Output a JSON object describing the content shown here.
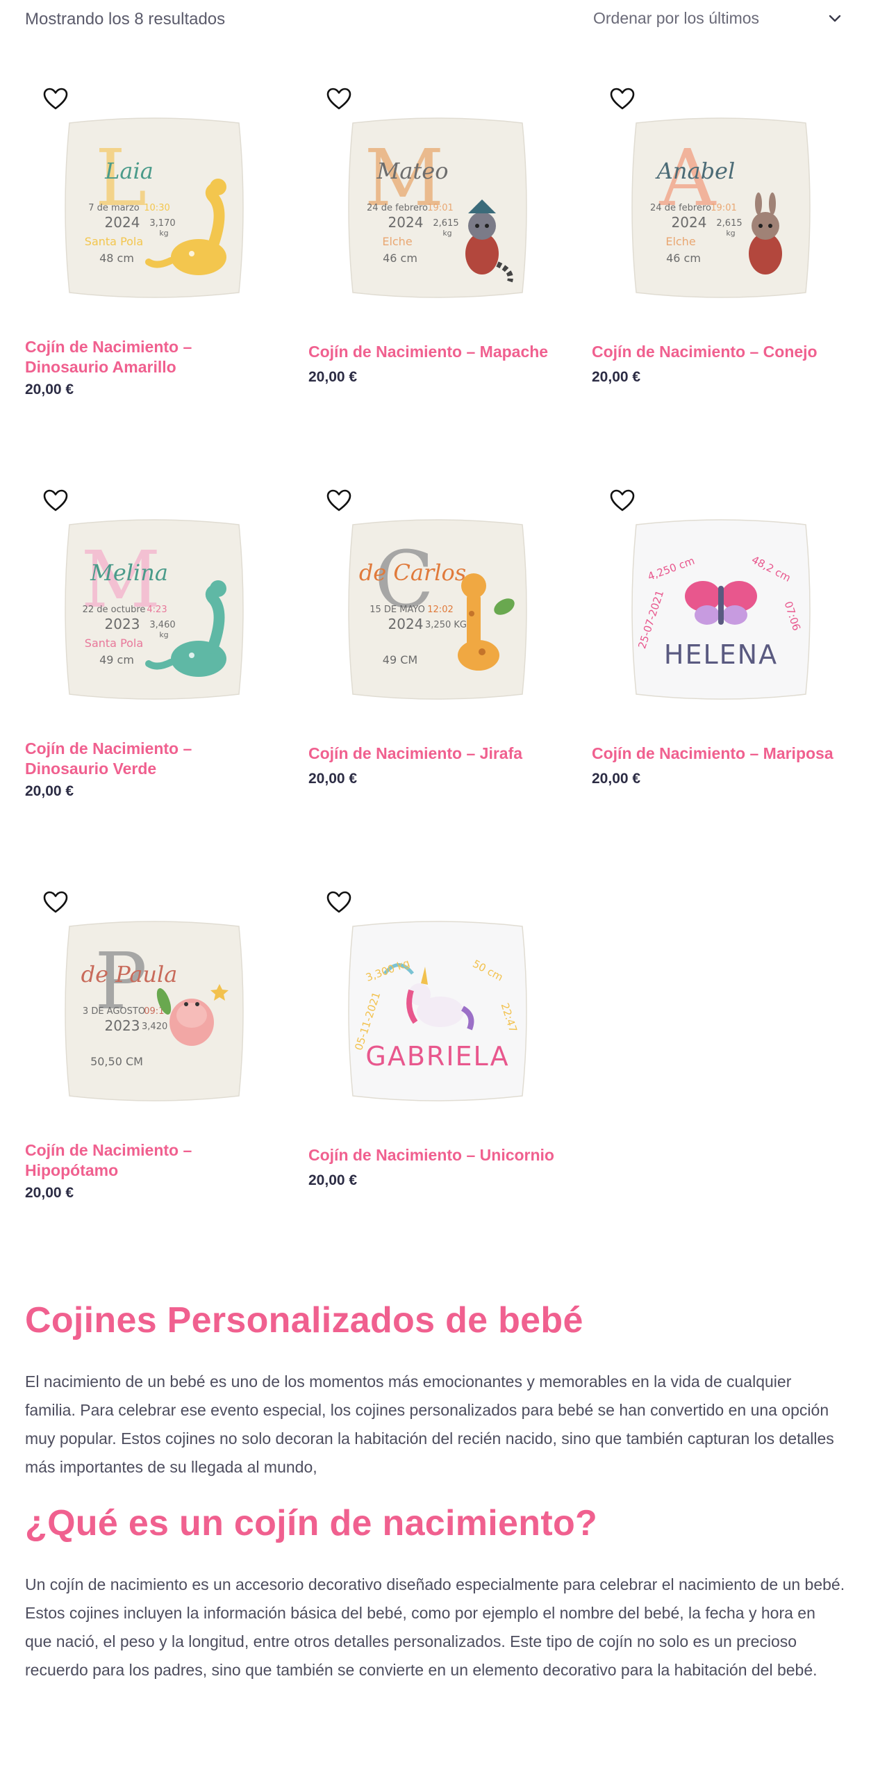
{
  "toolbar": {
    "result_count": "Mostrando los 8 resultados",
    "sort_value": "Ordenar por los últimos"
  },
  "products": [
    {
      "title_line1": "Cojín de Nacimiento –",
      "title_line2": "Dinosaurio Amarillo",
      "price": "20,00 €",
      "pillow": {
        "background": "#f1eee6",
        "letter": "L",
        "letter_color": "#f4cf7a",
        "name": "Laia",
        "name_color": "#4a9b8a",
        "date": "7 de marzo",
        "time": "10:30",
        "year": "2024",
        "weight": "3,170",
        "unit": "kg",
        "city": "Santa Pola",
        "length": "48 cm",
        "accent": "#f3c64e",
        "animal": "yellow-dinosaur"
      }
    },
    {
      "title_line1": "Cojín de Nacimiento – Mapache",
      "title_line2": "",
      "price": "20,00 €",
      "pillow": {
        "background": "#f1eee6",
        "letter": "M",
        "letter_color": "#e9b27e",
        "name": "Mateo",
        "name_color": "#6d6d6d",
        "date": "24 de febrero",
        "time": "19:01",
        "year": "2024",
        "weight": "2,615",
        "unit": "kg",
        "city": "Elche",
        "length": "46 cm",
        "accent": "#e9a772",
        "animal": "raccoon"
      }
    },
    {
      "title_line1": "Cojín de Nacimiento – Conejo",
      "title_line2": "",
      "price": "20,00 €",
      "pillow": {
        "background": "#f1eee6",
        "letter": "A",
        "letter_color": "#f2a98f",
        "name": "Anabel",
        "name_color": "#4b6b76",
        "date": "24 de febrero",
        "time": "19:01",
        "year": "2024",
        "weight": "2,615",
        "unit": "kg",
        "city": "Elche",
        "length": "46 cm",
        "accent": "#e9a772",
        "animal": "rabbit"
      }
    },
    {
      "title_line1": "Cojín de Nacimiento –",
      "title_line2": "Dinosaurio Verde",
      "price": "20,00 €",
      "pillow": {
        "background": "#f1eee6",
        "letter": "M",
        "letter_color": "#f4b8cf",
        "name": "Melina",
        "name_color": "#4a9b8a",
        "date": "22 de octubre",
        "time": "4:23",
        "year": "2023",
        "weight": "3,460",
        "unit": "kg",
        "city": "Santa Pola",
        "length": "49 cm",
        "accent": "#e8789a",
        "animal": "green-dinosaur"
      }
    },
    {
      "title_line1": "Cojín de Nacimiento – Jirafa",
      "title_line2": "",
      "price": "20,00 €",
      "pillow": {
        "background": "#f1eee6",
        "letter": "C",
        "letter_color": "#9a9a9a",
        "name": "de Carlos",
        "name_color": "#e07a3b",
        "date": "15 DE MAYO",
        "time": "12:02",
        "year": "2024",
        "weight": "3,250 KG",
        "unit": "",
        "city": "",
        "length": "49 CM",
        "accent": "#e07a3b",
        "animal": "giraffe"
      }
    },
    {
      "title_line1": "Cojín de Nacimiento – Mariposa",
      "title_line2": "",
      "price": "20,00 €",
      "pillow": {
        "background": "#f7f7f8",
        "letter": "",
        "letter_color": "#e8578d",
        "name": "HELENA",
        "name_color": "#5a5a80",
        "date": "25-07-2021",
        "time": "07:06",
        "year": "",
        "weight": "4,250 cm",
        "unit": "",
        "city": "",
        "length": "48,2 cm",
        "accent": "#e8578d",
        "animal": "butterfly"
      }
    },
    {
      "title_line1": "Cojín de Nacimiento –",
      "title_line2": "Hipopótamo",
      "price": "20,00 €",
      "pillow": {
        "background": "#f1eee6",
        "letter": "P",
        "letter_color": "#9a9a9a",
        "name": "de Paula",
        "name_color": "#c86a5a",
        "date": "3 DE AGOSTO",
        "time": "09:17",
        "year": "2023",
        "weight": "3,420 KG",
        "unit": "",
        "city": "",
        "length": "50,50 CM",
        "accent": "#c86a5a",
        "animal": "hippo"
      }
    },
    {
      "title_line1": "Cojín de Nacimiento – Unicornio",
      "title_line2": "",
      "price": "20,00 €",
      "pillow": {
        "background": "#f7f7f8",
        "letter": "",
        "letter_color": "#e8578d",
        "name": "GABRIELA",
        "name_color": "#e8578d",
        "date": "05-11-2021",
        "time": "22:47",
        "year": "",
        "weight": "3,300 kg",
        "unit": "",
        "city": "",
        "length": "50 cm",
        "accent": "#f2c14e",
        "animal": "unicorn"
      }
    }
  ],
  "article": {
    "heading1": "Cojines Personalizados de bebé",
    "paragraph1": "El nacimiento de un bebé es uno de los momentos más emocionantes y memorables en la vida de cualquier familia. Para celebrar ese evento especial, los cojines personalizados para bebé se han convertido en una opción muy popular. Estos cojines no solo decoran la habitación del recién nacido, sino que también capturan los detalles más importantes de su llegada al mundo,",
    "heading2": "¿Qué es un cojín de nacimiento?",
    "paragraph2": "Un cojín de nacimiento es un accesorio decorativo diseñado especialmente para celebrar el nacimiento de un bebé. Estos cojines incluyen la información básica del bebé, como por ejemplo el nombre del bebé, la fecha y hora en que nació, el peso y la longitud, entre otros detalles personalizados. Este tipo de cojín no solo es un precioso recuerdo para los padres, sino que también se convierte en un elemento decorativo para la habitación del bebé."
  },
  "colors": {
    "accent": "#f0608f",
    "price": "#2c2c44",
    "text": "#4d4d5e"
  }
}
